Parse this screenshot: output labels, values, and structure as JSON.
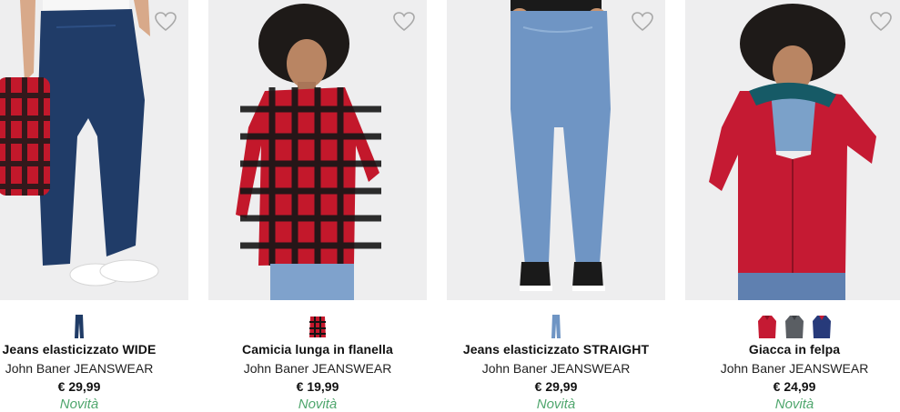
{
  "products": [
    {
      "name": "Jeans elasticizzato WIDE",
      "brand": "John Baner JEANSWEAR",
      "price": "€ 29,99",
      "badge": "Novità",
      "swatches": [
        "dark-denim"
      ]
    },
    {
      "name": "Camicia lunga in flanella",
      "brand": "John Baner JEANSWEAR",
      "price": "€ 19,99",
      "badge": "Novità",
      "swatches": [
        "red-plaid"
      ]
    },
    {
      "name": "Jeans elasticizzato STRAIGHT",
      "brand": "John Baner JEANSWEAR",
      "price": "€ 29,99",
      "badge": "Novità",
      "swatches": [
        "light-denim"
      ]
    },
    {
      "name": "Giacca in felpa",
      "brand": "John Baner JEANSWEAR",
      "price": "€ 24,99",
      "badge": "Novità",
      "swatches": [
        "red",
        "grey",
        "navy"
      ]
    }
  ],
  "colors": {
    "badge_green": "#4fa66d",
    "dark_denim": "#1f3b66",
    "light_denim": "#6f95c4",
    "plaid_red": "#c3182b",
    "jacket_red": "#c51a33",
    "grey": "#5a5e63",
    "navy": "#273a7a"
  },
  "icons": {
    "wishlist": "heart-outline-icon"
  }
}
